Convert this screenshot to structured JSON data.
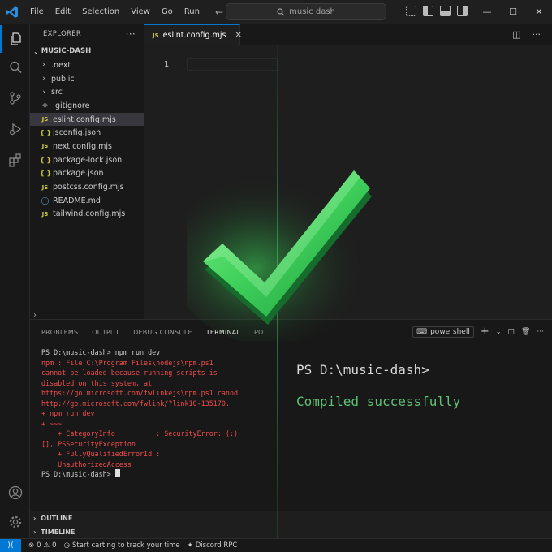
{
  "titlebar": {
    "menu": [
      "File",
      "Edit",
      "Selection",
      "View",
      "Go",
      "Run"
    ],
    "search_text": "music dash"
  },
  "sidebar": {
    "header": "EXPLORER",
    "root": "MUSIC-DASH",
    "items": [
      {
        "label": ".next",
        "kind": "folder"
      },
      {
        "label": "public",
        "kind": "folder"
      },
      {
        "label": "src",
        "kind": "folder"
      },
      {
        "label": ".gitignore",
        "kind": "git"
      },
      {
        "label": "eslint.config.mjs",
        "kind": "js",
        "selected": true
      },
      {
        "label": "jsconfig.json",
        "kind": "json"
      },
      {
        "label": "next.config.mjs",
        "kind": "js"
      },
      {
        "label": "package-lock.json",
        "kind": "json"
      },
      {
        "label": "package.json",
        "kind": "json"
      },
      {
        "label": "postcss.config.mjs",
        "kind": "js"
      },
      {
        "label": "README.md",
        "kind": "md"
      },
      {
        "label": "tailwind.config.mjs",
        "kind": "js"
      }
    ]
  },
  "editor": {
    "tab_label": "eslint.config.mjs",
    "tab_icon": "JS",
    "line_number": "1"
  },
  "panel": {
    "tabs": [
      "PROBLEMS",
      "OUTPUT",
      "DEBUG CONSOLE",
      "TERMINAL",
      "PO"
    ],
    "shell": "powershell",
    "terminal_lines": [
      {
        "text": "PS D:\\music-dash> npm run dev",
        "type": "cmd"
      },
      {
        "text": "npm : File C:\\Program Files\\nodejs\\npm.ps1",
        "type": "err"
      },
      {
        "text": "cannot be loaded because running scripts is",
        "type": "err"
      },
      {
        "text": "disabled on this system, at",
        "type": "err"
      },
      {
        "text": "https://go.microsoft.com/fwlinkejs\\npm.ps1 canod",
        "type": "err"
      },
      {
        "text": "http://go.microsoft.com/fwlink/?link10-135170.",
        "type": "err"
      },
      {
        "text": "+ npm run dev",
        "type": "err"
      },
      {
        "text": "+ ~~~",
        "type": "err"
      },
      {
        "text": "    + CategoryInfo          : SecurityError: (:)",
        "type": "err"
      },
      {
        "text": "[], PSSecurityException",
        "type": "err"
      },
      {
        "text": "    + FullyQualifiedErrorId :",
        "type": "err"
      },
      {
        "text": "    UnauthorizedAccess",
        "type": "err"
      }
    ],
    "final_prompt": "PS D:\\music-dash> ",
    "right_prompt": "PS D:\\music-dash>",
    "right_success": "Compiled successfully"
  },
  "sections": {
    "outline": "OUTLINE",
    "timeline": "TIMELINE"
  },
  "statusbar": {
    "errors": "0",
    "warnings": "0",
    "track_text": "Start carting to track your time",
    "discord": "Discord RPC"
  },
  "colors": {
    "accent": "#0078d4",
    "error": "#f14c4c",
    "success": "#5fc172",
    "check_green": "#3ecf5a"
  }
}
